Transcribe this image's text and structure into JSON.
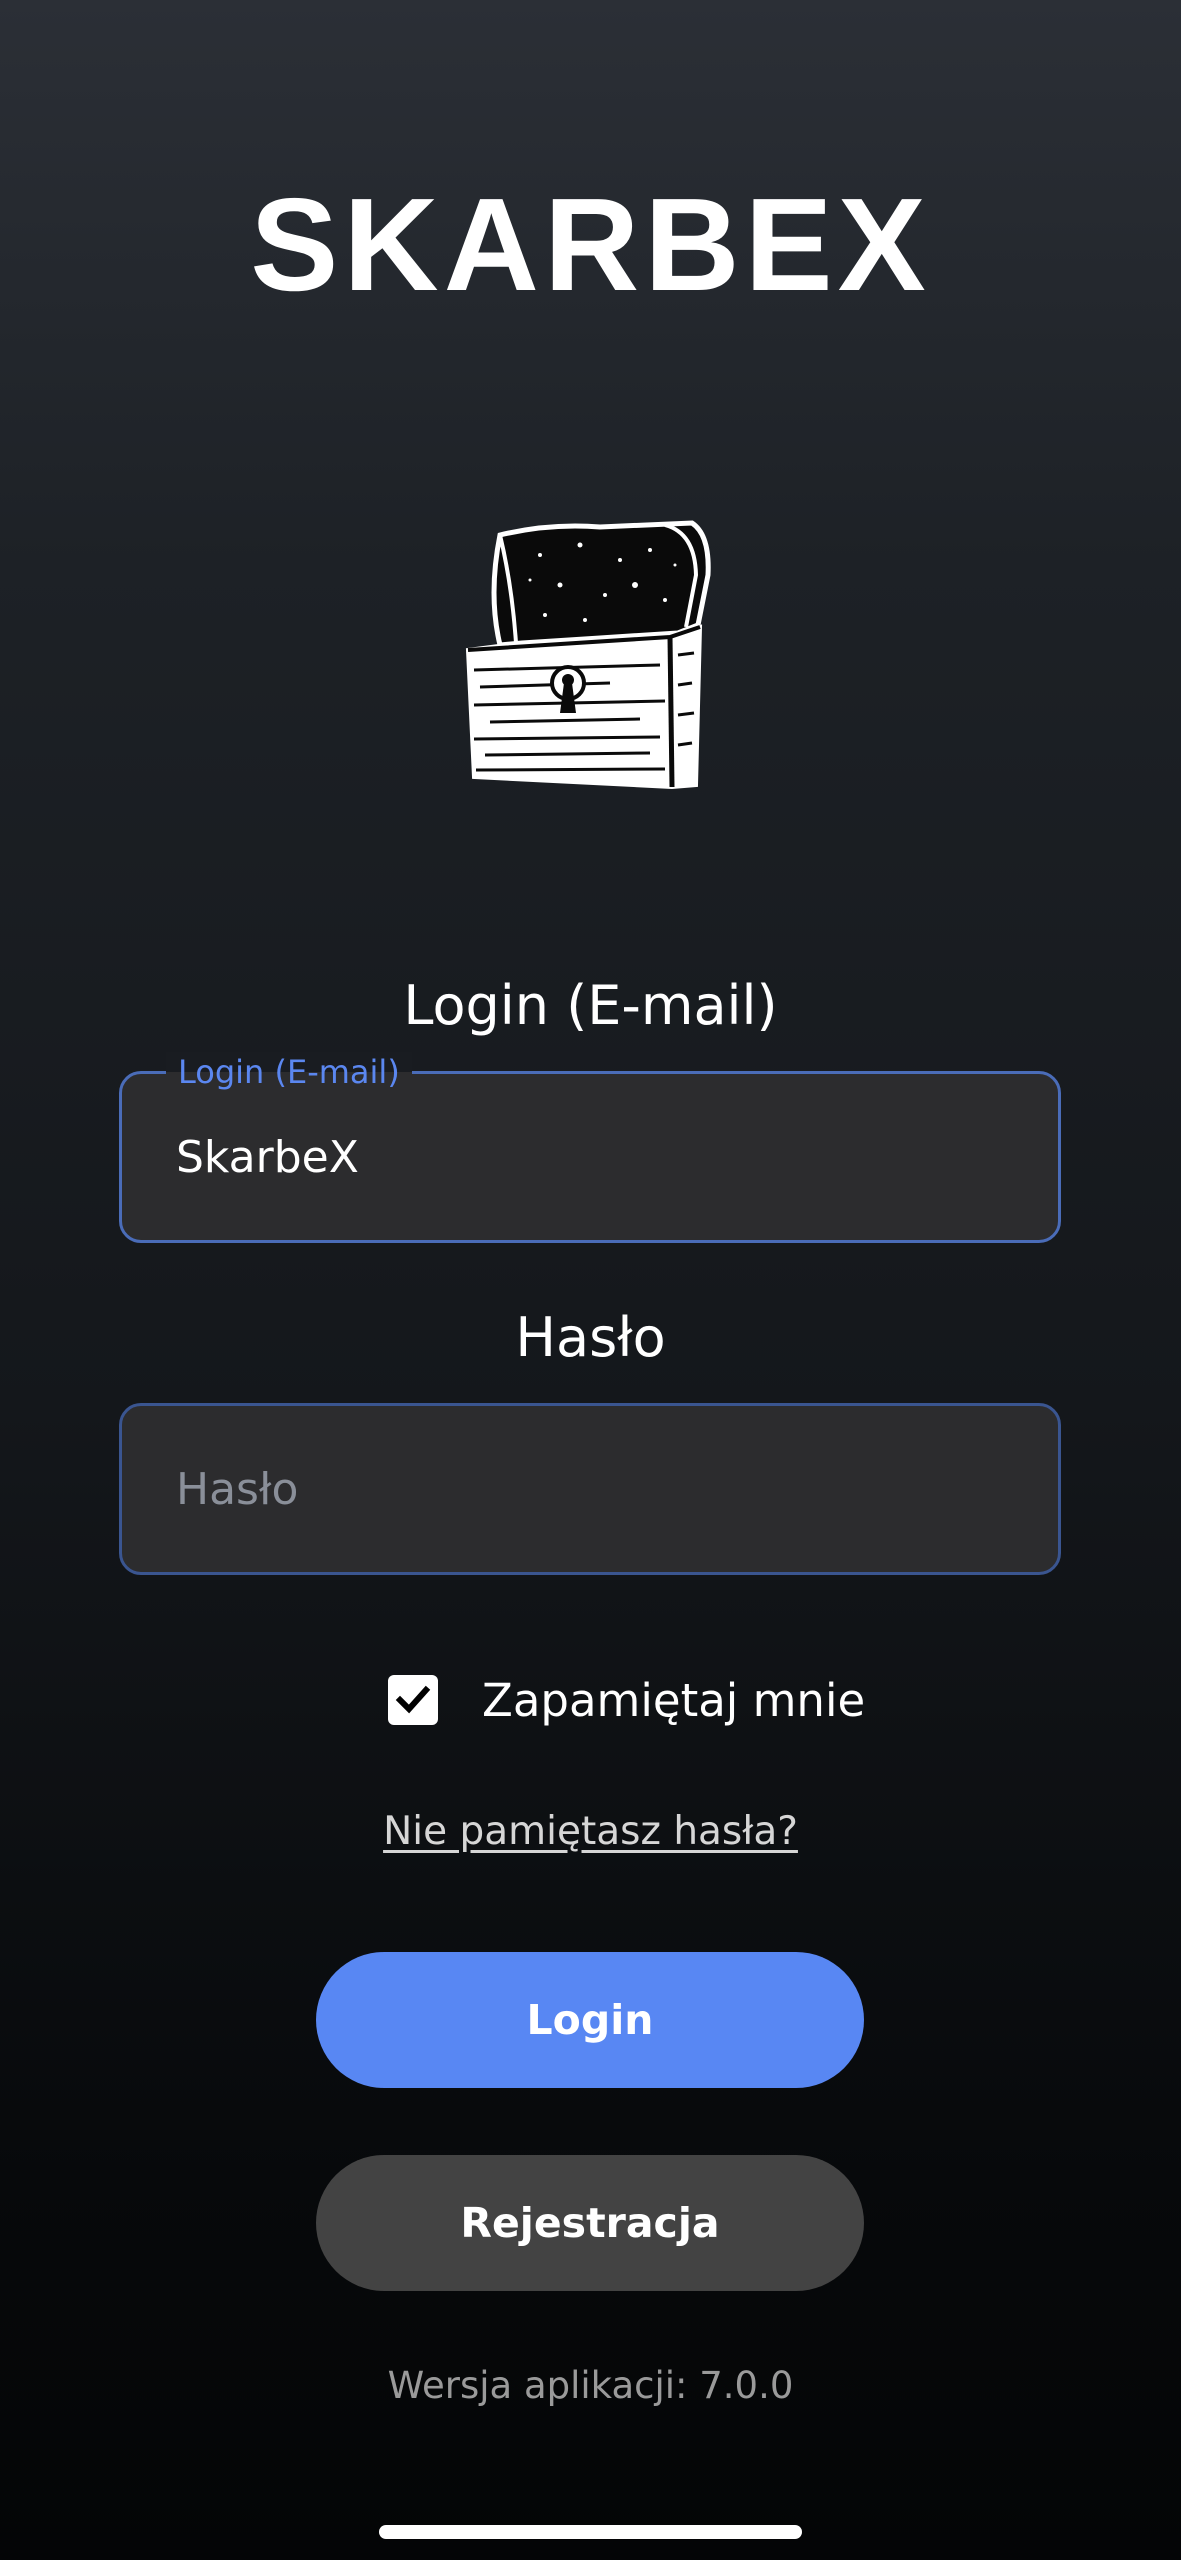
{
  "app": {
    "title": "SKARBEX",
    "logo_icon": "treasure-chest-icon"
  },
  "login_field": {
    "heading": "Login (E-mail)",
    "floating_label": "Login (E-mail)",
    "value": "SkarbeX",
    "accent_color": "#5b87f0"
  },
  "password_field": {
    "heading": "Hasło",
    "value": "",
    "placeholder": "Hasło"
  },
  "remember_me": {
    "label": "Zapamiętaj mnie",
    "checked": true,
    "icon": "checkmark-icon"
  },
  "forgot_password": {
    "label": "Nie pamiętasz hasła?"
  },
  "buttons": {
    "login_label": "Login",
    "login_color": "#5887f3",
    "register_label": "Rejestracja",
    "register_color": "#434343"
  },
  "footer": {
    "version_text": "Wersja aplikacji: 7.0.0"
  }
}
